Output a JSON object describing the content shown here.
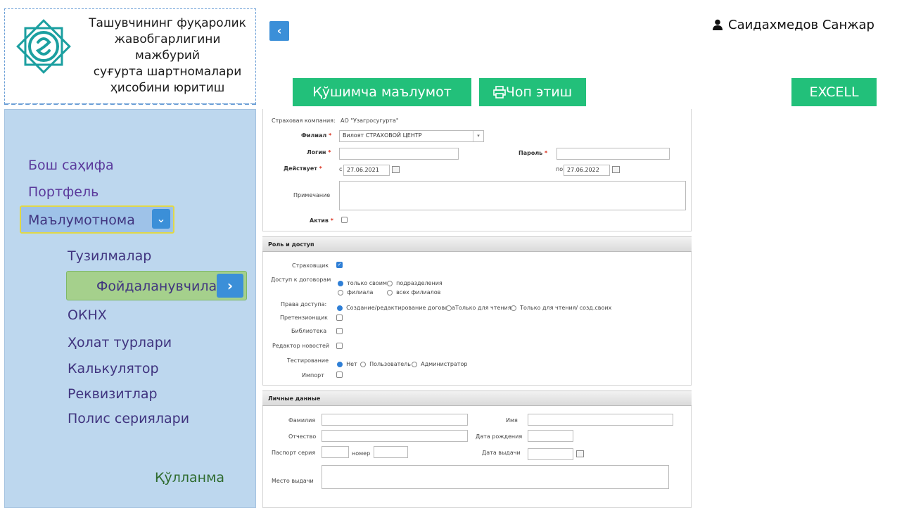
{
  "logo": {
    "title_lines": [
      "Ташувчининг фуқаролик",
      "жавобгарлигини мажбурий",
      "суғурта шартномалари",
      "ҳисобини юритиш"
    ]
  },
  "sidebar": {
    "items": [
      "Бош саҳифа",
      "Портфель",
      "Маълумотнома"
    ],
    "sub_items": [
      "Тузилмалар",
      "Фойдаланувчилар",
      "ОКНХ",
      "Ҳолат турлари",
      "Калькулятор",
      "Реквизитлар",
      "Полис сериялари"
    ],
    "manual": "Қўлланма"
  },
  "header": {
    "user_name": "Саидахмедов Санжар",
    "collapse_icon": "chevron-left-icon"
  },
  "toolbar": {
    "extra_info": "Қўшимча маълумот",
    "print": "Чоп этиш",
    "excel": "EXCELL"
  },
  "form": {
    "company_label": "Страховая компания:",
    "company_value": "АО \"Узагросугурта\"",
    "branch_label": "Филиал",
    "branch_value": "Вилоят СТРАХОВОЙ ЦЕНТР",
    "login_label": "Логин",
    "password_label": "Пароль",
    "valid_label": "Действует",
    "from_prefix": "с",
    "from_date": "27.06.2021",
    "to_prefix": "по",
    "to_date": "27.06.2022",
    "note_label": "Примечание",
    "active_label": "Актив",
    "required_mark": "*"
  },
  "roles": {
    "section_title": "Роль и доступ",
    "insurer_label": "Страховщик",
    "contract_access_label": "Доступ к договорам",
    "contract_access_options": [
      "только своим",
      "подразделения",
      "филиала",
      "всех филиалов"
    ],
    "rights_label": "Права доступа:",
    "rights_options": [
      "Создание/редактирование договора",
      "Только для чтения",
      "Только для чтения/ созд.своих"
    ],
    "claims_label": "Претензионщик",
    "library_label": "Библиотека",
    "news_editor_label": "Редактор новостей",
    "testing_label": "Тестирование",
    "testing_options": [
      "Нет",
      "Пользователь",
      "Администратор"
    ],
    "import_label": "Импорт"
  },
  "personal": {
    "section_title": "Личные данные",
    "surname_label": "Фамилия",
    "name_label": "Имя",
    "patronymic_label": "Отчество",
    "birth_label": "Дата рождения",
    "passport_label": "Паспорт серия",
    "number_label": "номер",
    "issue_date_label": "Дата выдачи",
    "issue_place_label": "Место выдачи"
  }
}
